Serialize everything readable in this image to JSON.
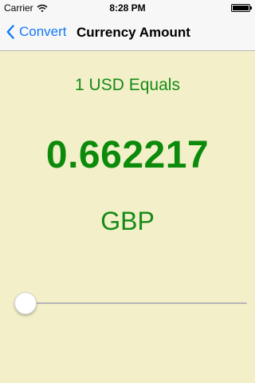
{
  "status_bar": {
    "carrier": "Carrier",
    "time": "8:28 PM",
    "battery_level": 1.0
  },
  "nav_bar": {
    "back_label": "Convert",
    "title": "Currency Amount"
  },
  "conversion": {
    "equals_text": "1 USD Equals",
    "rate": "0.662217",
    "target_currency": "GBP"
  },
  "slider": {
    "value": 0.0
  },
  "colors": {
    "background": "#f3f0c9",
    "accent": "#1378f7",
    "value_green": "#0b8a0b"
  },
  "icons": {
    "back": "chevron-left-icon",
    "wifi": "wifi-icon",
    "battery": "battery-icon"
  }
}
